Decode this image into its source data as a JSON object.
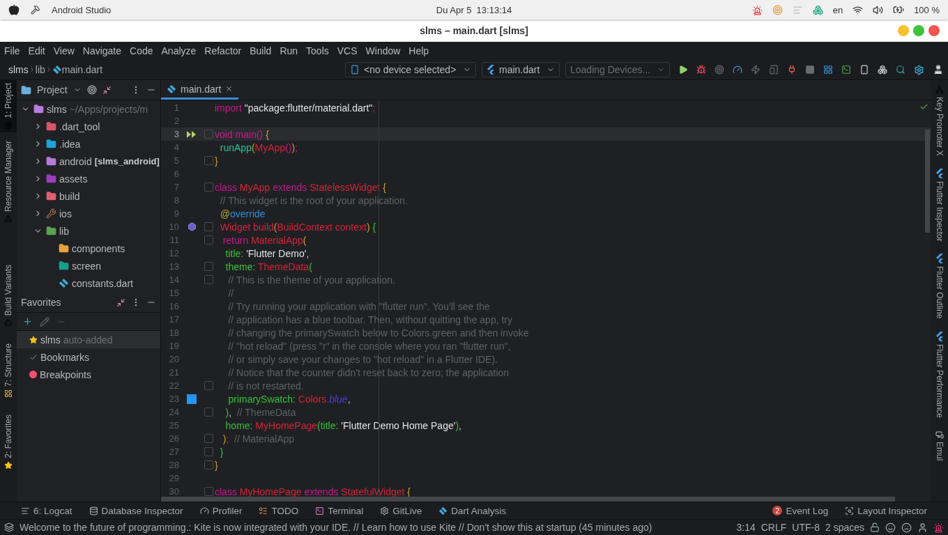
{
  "os_bar": {
    "app_name": "Android Studio",
    "clock": "Du Apr 5  13:13:14",
    "language": "en",
    "battery": "100 %"
  },
  "window": {
    "title": "slms – main.dart [slms]"
  },
  "menu": [
    "File",
    "Edit",
    "View",
    "Navigate",
    "Code",
    "Analyze",
    "Refactor",
    "Build",
    "Run",
    "Tools",
    "VCS",
    "Window",
    "Help"
  ],
  "breadcrumbs": [
    "slms",
    "lib",
    "main.dart"
  ],
  "toolbar": {
    "device": "<no device selected>",
    "run_config": "main.dart",
    "devices": "Loading Devices..."
  },
  "left_strip": [
    {
      "label": "1: Project",
      "selected": true
    },
    {
      "label": "Resource Manager",
      "selected": false
    },
    {
      "label": "Build Variants",
      "selected": false
    },
    {
      "label": "7: Structure",
      "selected": false
    },
    {
      "label": "2: Favorites",
      "selected": false
    }
  ],
  "right_strip": [
    "Key Promoter X",
    "Flutter Inspector",
    "Flutter Outline",
    "Flutter Performance",
    "Emul"
  ],
  "project_panel": {
    "title": "Project",
    "tree": [
      {
        "name": "slms",
        "path": "~/Apps/projects/m",
        "kind": "module",
        "expanded": true,
        "children": [
          {
            "name": ".dart_tool",
            "kind": "folder",
            "expanded": false
          },
          {
            "name": ".idea",
            "kind": "idea",
            "expanded": false
          },
          {
            "name": "android",
            "tag": "[slms_android]",
            "kind": "module",
            "expanded": false
          },
          {
            "name": "assets",
            "kind": "assets",
            "expanded": false
          },
          {
            "name": "build",
            "kind": "build",
            "expanded": false
          },
          {
            "name": "ios",
            "kind": "ios",
            "expanded": false
          },
          {
            "name": "lib",
            "kind": "source",
            "expanded": true,
            "children": [
              {
                "name": "components",
                "kind": "package"
              },
              {
                "name": "screen",
                "kind": "screen"
              },
              {
                "name": "constants.dart",
                "kind": "dart"
              }
            ]
          }
        ]
      }
    ]
  },
  "favorites": {
    "title": "Favorites",
    "items": [
      {
        "label": "slms",
        "note": "auto-added",
        "kind": "star",
        "selected": true
      },
      {
        "label": "Bookmarks",
        "kind": "check",
        "selected": false
      },
      {
        "label": "Breakpoints",
        "kind": "breakpoint",
        "selected": false
      }
    ]
  },
  "editor": {
    "tabs": [
      {
        "label": "main.dart",
        "selected": true
      }
    ],
    "lines": [
      {
        "number": "1",
        "current": false,
        "fold": false,
        "tokens": [
          {
            "kind": "keyword",
            "text": "import"
          },
          {
            "kind": "string",
            "text": " \"package:flutter/material.dart\""
          },
          {
            "kind": "keyword",
            "text": ";"
          }
        ]
      },
      {
        "number": "2",
        "current": false,
        "fold": false
      },
      {
        "number": "3",
        "current": true,
        "fold": true,
        "gutter": {
          "kind": "run"
        },
        "tokens": [
          {
            "kind": "keyword",
            "text": "void main"
          },
          {
            "kind": "keyword",
            "text": "()"
          },
          {
            "kind": "bracket",
            "text": " {"
          }
        ]
      },
      {
        "number": "4",
        "current": false,
        "fold": false,
        "tokens": [
          {
            "kind": "fn",
            "text": "  runApp"
          },
          {
            "kind": "bracket",
            "text": "("
          },
          {
            "kind": "type",
            "text": "MyApp"
          },
          {
            "kind": "keyword",
            "text": "()"
          },
          {
            "kind": "bracket",
            "text": ")"
          },
          {
            "kind": "keyword",
            "text": ";"
          }
        ]
      },
      {
        "number": "5",
        "current": false,
        "fold": true,
        "tokens": [
          {
            "kind": "bracket",
            "text": "}"
          }
        ]
      },
      {
        "number": "6",
        "current": false,
        "fold": false
      },
      {
        "number": "7",
        "current": false,
        "fold": true,
        "tokens": [
          {
            "kind": "keyword",
            "text": "class "
          },
          {
            "kind": "type",
            "text": "MyApp "
          },
          {
            "kind": "keyword",
            "text": "extends "
          },
          {
            "kind": "type",
            "text": "StatelessWidget "
          },
          {
            "kind": "bracket",
            "text": "{"
          }
        ]
      },
      {
        "number": "8",
        "current": false,
        "fold": false,
        "tokens": [
          {
            "kind": "comment",
            "text": "  // This widget is the root of your application."
          }
        ]
      },
      {
        "number": "9",
        "current": false,
        "fold": false,
        "tokens": [
          {
            "kind": "annotation",
            "text": "  @"
          },
          {
            "kind": "meta",
            "text": "override"
          }
        ]
      },
      {
        "number": "10",
        "current": false,
        "fold": true,
        "gutter": {
          "kind": "override"
        },
        "tokens": [
          {
            "kind": "type",
            "text": "  Widget build"
          },
          {
            "kind": "bracket",
            "text": "("
          },
          {
            "kind": "type",
            "text": "BuildContext context"
          },
          {
            "kind": "bracket",
            "text": ")"
          },
          {
            "kind": "prop",
            "text": " {"
          }
        ]
      },
      {
        "number": "11",
        "current": false,
        "fold": true,
        "tokens": [
          {
            "kind": "keyword",
            "text": "   return "
          },
          {
            "kind": "type",
            "text": "MaterialApp"
          },
          {
            "kind": "bracket",
            "text": "("
          }
        ]
      },
      {
        "number": "12",
        "current": false,
        "fold": false,
        "tokens": [
          {
            "kind": "prop",
            "text": "    title: "
          },
          {
            "kind": "string",
            "text": "'Flutter Demo'"
          },
          {
            "kind": "plain",
            "text": ","
          }
        ]
      },
      {
        "number": "13",
        "current": false,
        "fold": true,
        "tokens": [
          {
            "kind": "prop",
            "text": "    theme: "
          },
          {
            "kind": "type",
            "text": "ThemeData"
          },
          {
            "kind": "prop",
            "text": "("
          }
        ]
      },
      {
        "number": "14",
        "current": false,
        "fold": true,
        "tokens": [
          {
            "kind": "comment",
            "text": "     // This is the theme of your application."
          }
        ]
      },
      {
        "number": "15",
        "current": false,
        "fold": false,
        "tokens": [
          {
            "kind": "comment",
            "text": "     //"
          }
        ]
      },
      {
        "number": "16",
        "current": false,
        "fold": false,
        "tokens": [
          {
            "kind": "comment",
            "text": "     // Try running your application with \"flutter run\". You'll see the"
          }
        ]
      },
      {
        "number": "17",
        "current": false,
        "fold": false,
        "tokens": [
          {
            "kind": "comment",
            "text": "     // application has a blue toolbar. Then, without quitting the app, try"
          }
        ]
      },
      {
        "number": "18",
        "current": false,
        "fold": false,
        "tokens": [
          {
            "kind": "comment",
            "text": "     // changing the primarySwatch below to Colors.green and then invoke"
          }
        ]
      },
      {
        "number": "19",
        "current": false,
        "fold": false,
        "tokens": [
          {
            "kind": "comment",
            "text": "     // \"hot reload\" (press \"r\" in the console where you ran \"flutter run\","
          }
        ]
      },
      {
        "number": "20",
        "current": false,
        "fold": false,
        "tokens": [
          {
            "kind": "comment",
            "text": "     // or simply save your changes to \"hot reload\" in a Flutter IDE)."
          }
        ]
      },
      {
        "number": "21",
        "current": false,
        "fold": false,
        "tokens": [
          {
            "kind": "comment",
            "text": "     // Notice that the counter didn't reset back to zero; the application"
          }
        ]
      },
      {
        "number": "22",
        "current": false,
        "fold": true,
        "tokens": [
          {
            "kind": "comment",
            "text": "     // is not restarted."
          }
        ]
      },
      {
        "number": "23",
        "current": false,
        "fold": false,
        "gutter": {
          "kind": "swatch",
          "color": "#2196f3"
        },
        "tokens": [
          {
            "kind": "prop",
            "text": "     primarySwatch: "
          },
          {
            "kind": "type",
            "text": "Colors."
          },
          {
            "kind": "constant",
            "text": "blue"
          },
          {
            "kind": "plain",
            "text": ","
          }
        ]
      },
      {
        "number": "24",
        "current": false,
        "fold": true,
        "tokens": [
          {
            "kind": "prop",
            "text": "    )"
          },
          {
            "kind": "plain",
            "text": ", "
          },
          {
            "kind": "comment",
            "text": " // ThemeData"
          }
        ]
      },
      {
        "number": "25",
        "current": false,
        "fold": false,
        "tokens": [
          {
            "kind": "prop",
            "text": "    home: "
          },
          {
            "kind": "type",
            "text": "MyHomePage"
          },
          {
            "kind": "prop",
            "text": "(title: "
          },
          {
            "kind": "string",
            "text": "'Flutter Demo Home Page'"
          },
          {
            "kind": "prop",
            "text": ")"
          },
          {
            "kind": "plain",
            "text": ","
          }
        ]
      },
      {
        "number": "26",
        "current": false,
        "fold": true,
        "tokens": [
          {
            "kind": "bracket",
            "text": "   )"
          },
          {
            "kind": "keyword",
            "text": ";"
          },
          {
            "kind": "comment",
            "text": "  // MaterialApp"
          }
        ]
      },
      {
        "number": "27",
        "current": false,
        "fold": true,
        "tokens": [
          {
            "kind": "prop",
            "text": "  }"
          }
        ]
      },
      {
        "number": "28",
        "current": false,
        "fold": true,
        "tokens": [
          {
            "kind": "bracket",
            "text": "}"
          }
        ]
      },
      {
        "number": "29",
        "current": false,
        "fold": false
      },
      {
        "number": "30",
        "current": false,
        "fold": true,
        "tokens": [
          {
            "kind": "keyword",
            "text": "class "
          },
          {
            "kind": "type",
            "text": "MyHomePage "
          },
          {
            "kind": "keyword",
            "text": "extends "
          },
          {
            "kind": "type",
            "text": "StatefulWidget "
          },
          {
            "kind": "bracket",
            "text": "{"
          }
        ]
      }
    ]
  },
  "tool_windows": {
    "left": [
      {
        "label": "6: Logcat",
        "kind": "logcat"
      },
      {
        "label": "Database Inspector",
        "kind": "database"
      },
      {
        "label": "Profiler",
        "kind": "profiler"
      },
      {
        "label": "TODO",
        "kind": "todo"
      },
      {
        "label": "Terminal",
        "kind": "terminal"
      },
      {
        "label": "GitLive",
        "kind": "gitlive"
      },
      {
        "label": "Dart Analysis",
        "kind": "dart"
      }
    ],
    "right": [
      {
        "label": "Event Log",
        "badge": "2",
        "kind": "event"
      },
      {
        "label": "Layout Inspector",
        "kind": "layout"
      }
    ]
  },
  "status_bar": {
    "message": "Welcome to the future of programming.: Kite is now integrated with your IDE. // Learn how to use Kite // Don't show this at startup (45 minutes ago)",
    "position": "3:14",
    "line_ending": "CRLF",
    "encoding": "UTF-8",
    "indent": "2 spaces"
  }
}
